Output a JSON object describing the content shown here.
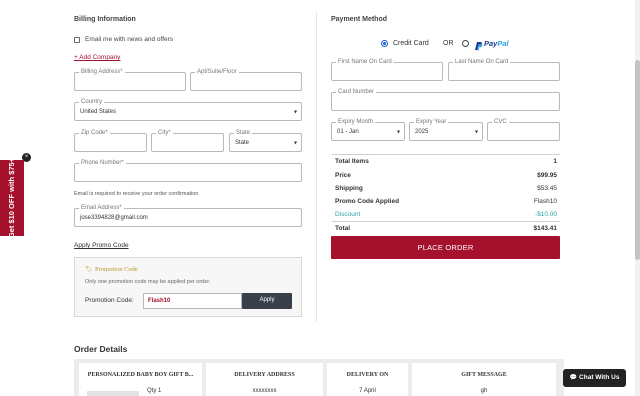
{
  "billing": {
    "title": "Billing Information",
    "email_optin_label": "Email me with news and offers",
    "add_company": "+ Add Company",
    "billing_address_label": "Billing Address*",
    "apt_label": "Apt/Suite/Floor",
    "country_label": "Country",
    "country_value": "United States",
    "zip_label": "Zip Code*",
    "city_label": "City*",
    "state_label": "State",
    "state_value": "State",
    "phone_label": "Phone Number*",
    "email_note": "Email is required to receive your order confirmation",
    "email_label": "Email Address*",
    "email_value": "jose3394828@gmail.com"
  },
  "promo": {
    "apply_link": "Apply Promo Code",
    "box_title": "Promotion Code",
    "note": "Only one promotion code may be applied per order.",
    "code_label": "Promotion Code:",
    "code_value": "Flash10",
    "apply_button": "Apply"
  },
  "payment": {
    "title": "Payment Method",
    "credit_card_label": "Credit Card",
    "or_label": "OR",
    "paypal_pay": "Pay",
    "paypal_pal": "Pal",
    "first_name_label": "First Name On Card",
    "last_name_label": "Last Name On Card",
    "card_number_label": "Card Number",
    "expiry_month_label": "Expiry Month",
    "expiry_month_value": "01 - Jan",
    "expiry_year_label": "Expiry Year",
    "expiry_year_value": "2025",
    "cvc_label": "CVC"
  },
  "summary": {
    "total_items_label": "Total Items",
    "total_items_value": "1",
    "price_label": "Price",
    "price_value": "$99.95",
    "shipping_label": "Shipping",
    "shipping_value": "$53.45",
    "promo_applied_label": "Promo Code Applied",
    "promo_applied_value": "Flash10",
    "discount_label": "Discount",
    "discount_value": "-$10.00",
    "total_label": "Total",
    "total_value": "$143.41",
    "place_order": "PLACE ORDER"
  },
  "side_offer": {
    "text": "Get $10 OFF with $75+",
    "close": "×"
  },
  "order_details": {
    "title": "Order Details",
    "cards": [
      {
        "header": "PERSONALIZED BABY BOY GIFT B...",
        "value": "Qty 1"
      },
      {
        "header": "DELIVERY ADDRESS",
        "value": "xxxxxxxx"
      },
      {
        "header": "DELIVERY ON",
        "value": "7 April"
      },
      {
        "header": "GIFT MESSAGE",
        "value": "gh"
      }
    ]
  },
  "chat": {
    "label": "Chat With Us"
  },
  "colors": {
    "brand": "#a5102d",
    "discount": "#2aa3a3",
    "radio_selected": "#1a5fd1",
    "dark_button": "#3a4049"
  }
}
